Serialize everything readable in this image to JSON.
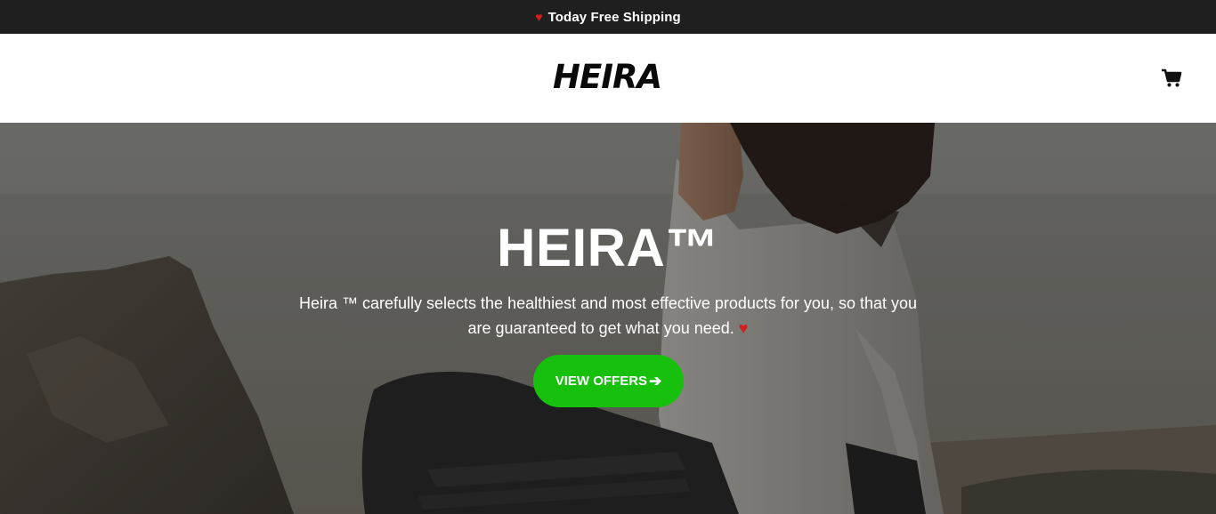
{
  "announcement": {
    "heart_icon": "heart-icon",
    "text": "Today Free Shipping"
  },
  "header": {
    "logo": "HEIRA",
    "cart_icon": "shopping-cart-icon"
  },
  "hero": {
    "title": "HEIRA™",
    "description": "Heira ™ carefully selects the healthiest and most effective products for you, so that you are guaranteed to get what you need.",
    "description_heart": "♥",
    "cta_label": "VIEW OFFERS",
    "cta_arrow": "➔",
    "background_image": "woman-in-yoga-pose-by-the-sea"
  },
  "colors": {
    "announcement_bg": "#1f1f1f",
    "heart": "#d0201e",
    "cta_bg": "#17c00d"
  }
}
